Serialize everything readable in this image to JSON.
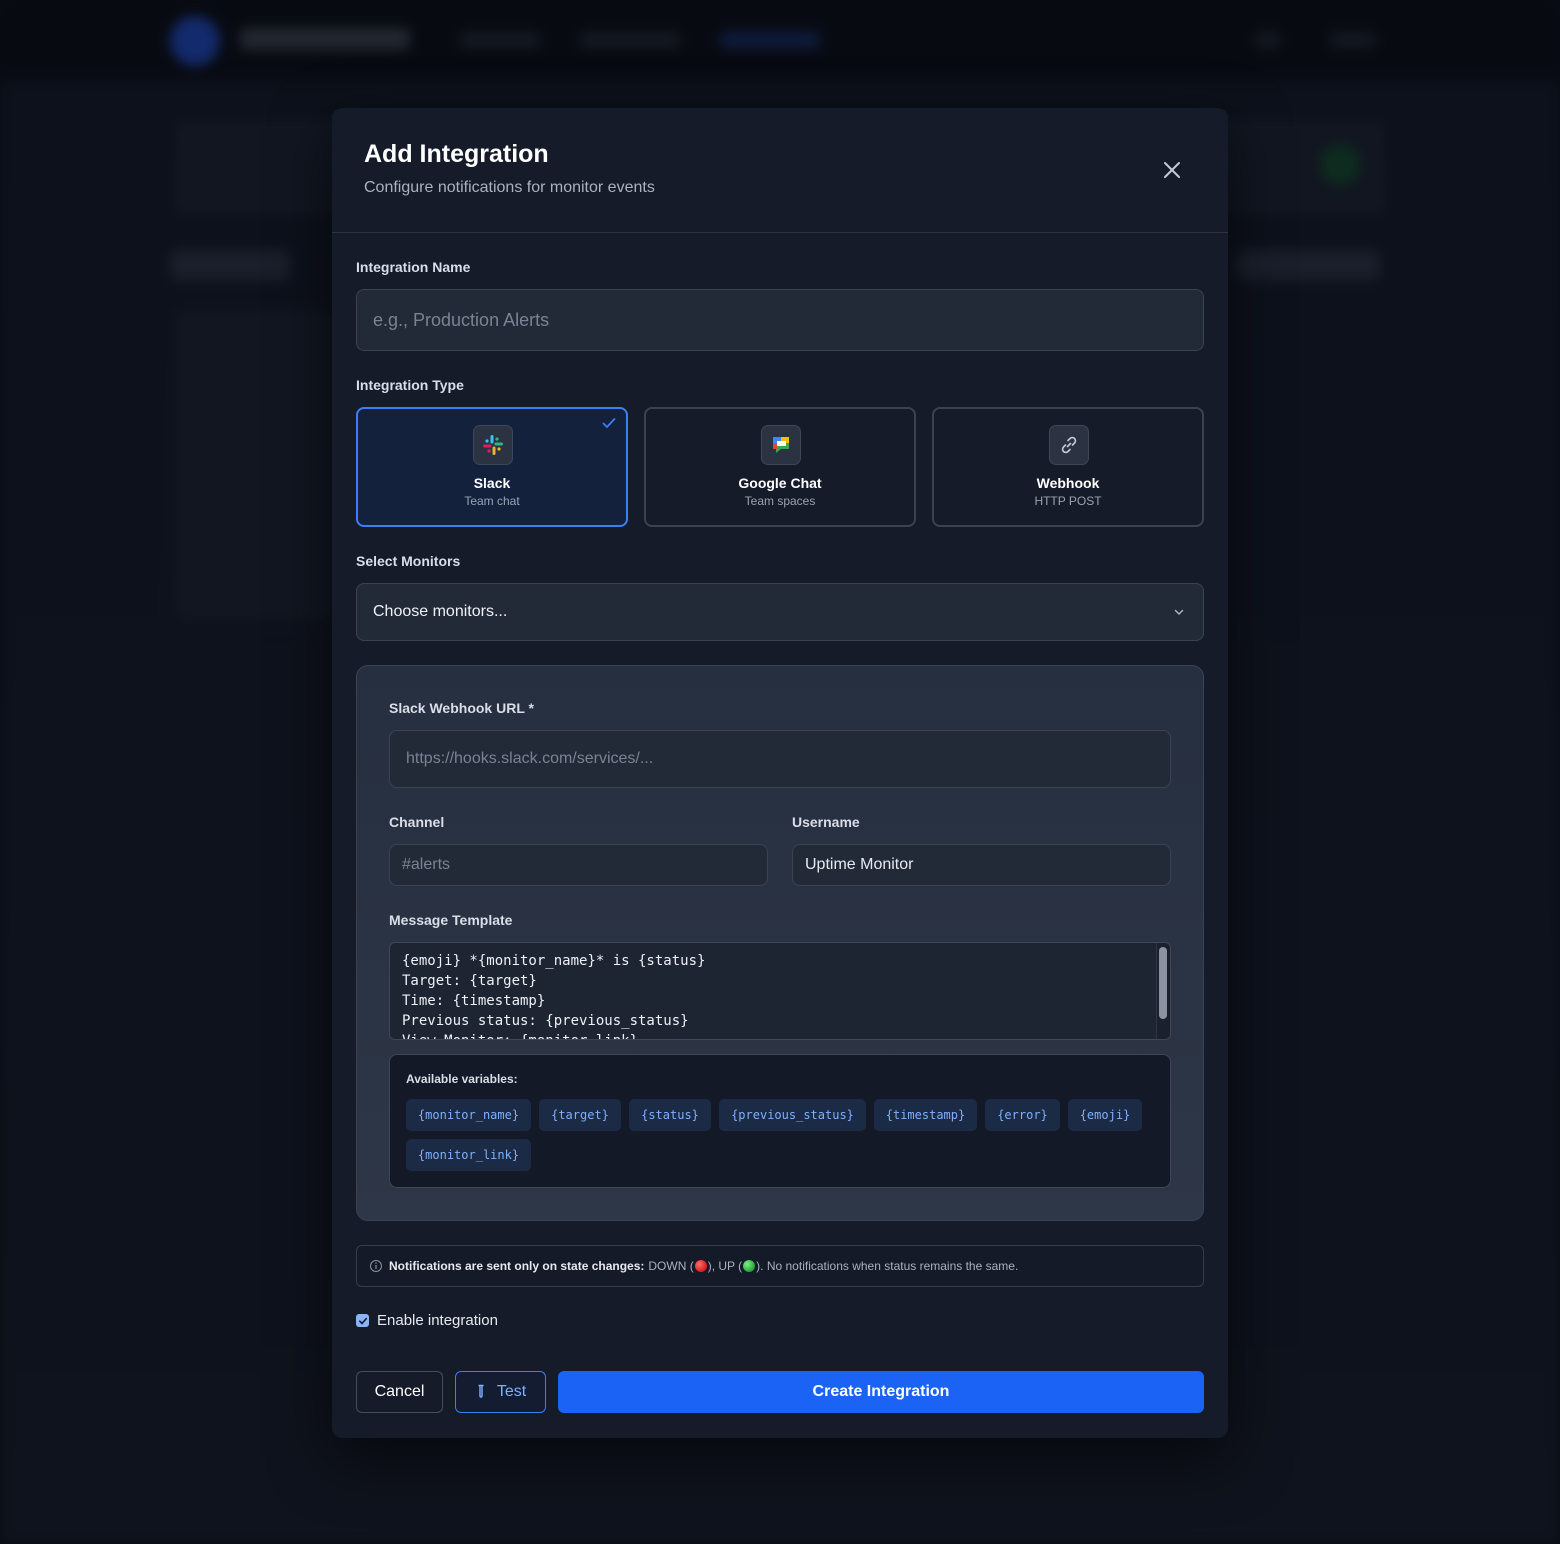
{
  "modal": {
    "title": "Add Integration",
    "subtitle": "Configure notifications for monitor events"
  },
  "integration_name": {
    "label": "Integration Name",
    "placeholder": "e.g., Production Alerts",
    "value": ""
  },
  "integration_type": {
    "label": "Integration Type",
    "options": [
      {
        "name": "Slack",
        "desc": "Team chat",
        "icon": "slack-icon",
        "selected": true
      },
      {
        "name": "Google Chat",
        "desc": "Team spaces",
        "icon": "google-chat-icon",
        "selected": false
      },
      {
        "name": "Webhook",
        "desc": "HTTP POST",
        "icon": "link-icon",
        "selected": false
      }
    ]
  },
  "monitors": {
    "label": "Select Monitors",
    "value": "Choose monitors..."
  },
  "slack": {
    "webhook_label": "Slack Webhook URL *",
    "webhook_placeholder": "https://hooks.slack.com/services/...",
    "channel_label": "Channel",
    "channel_placeholder": "#alerts",
    "username_label": "Username",
    "username_value": "Uptime Monitor",
    "template_label": "Message Template",
    "template_value": "{emoji} *{monitor_name}* is {status}\nTarget: {target}\nTime: {timestamp}\nPrevious status: {previous_status}\nView Monitor: {monitor_link}"
  },
  "variables": {
    "title": "Available variables:",
    "items": [
      "{monitor_name}",
      "{target}",
      "{status}",
      "{previous_status}",
      "{timestamp}",
      "{error}",
      "{emoji}",
      "{monitor_link}"
    ]
  },
  "notice": {
    "bold": "Notifications are sent only on state changes:",
    "down": "DOWN (",
    "mid": "), UP (",
    "rest": "). No notifications when status remains the same."
  },
  "enable": {
    "label": "Enable integration",
    "checked": true
  },
  "buttons": {
    "cancel": "Cancel",
    "test": "Test",
    "create": "Create Integration"
  },
  "colors": {
    "accent": "#1a63f5",
    "selected_border": "#3b7ef5",
    "chip_text": "#7fb0ff"
  }
}
